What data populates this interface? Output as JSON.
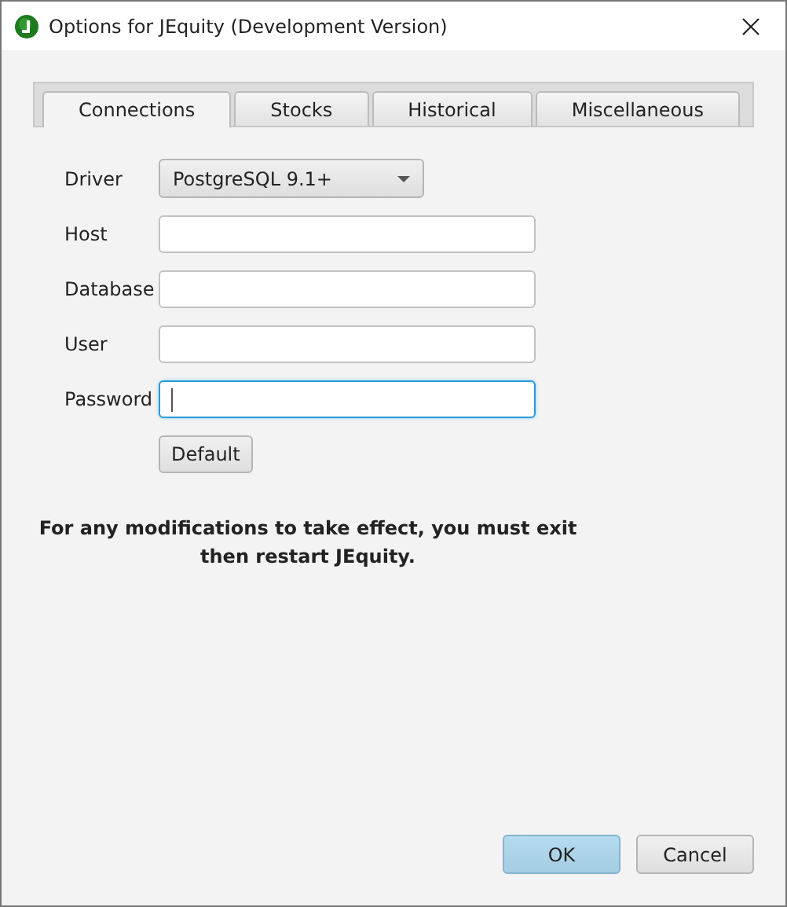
{
  "window": {
    "title": "Options for JEquity (Development Version)"
  },
  "tabs": [
    {
      "label": "Connections",
      "selected": true
    },
    {
      "label": "Stocks",
      "selected": false
    },
    {
      "label": "Historical",
      "selected": false
    },
    {
      "label": "Miscellaneous",
      "selected": false
    }
  ],
  "form": {
    "driver": {
      "label": "Driver",
      "value": "PostgreSQL 9.1+"
    },
    "fields": [
      {
        "label": "Host",
        "focused": false
      },
      {
        "label": "Database",
        "focused": false
      },
      {
        "label": "User",
        "focused": false
      },
      {
        "label": "Password",
        "focused": true
      }
    ],
    "default_button": "Default"
  },
  "message": "For any modifications to take effect, you must exit then restart JEquity.",
  "buttons": [
    {
      "label": "OK",
      "default": true
    },
    {
      "label": "Cancel",
      "default": false
    }
  ]
}
